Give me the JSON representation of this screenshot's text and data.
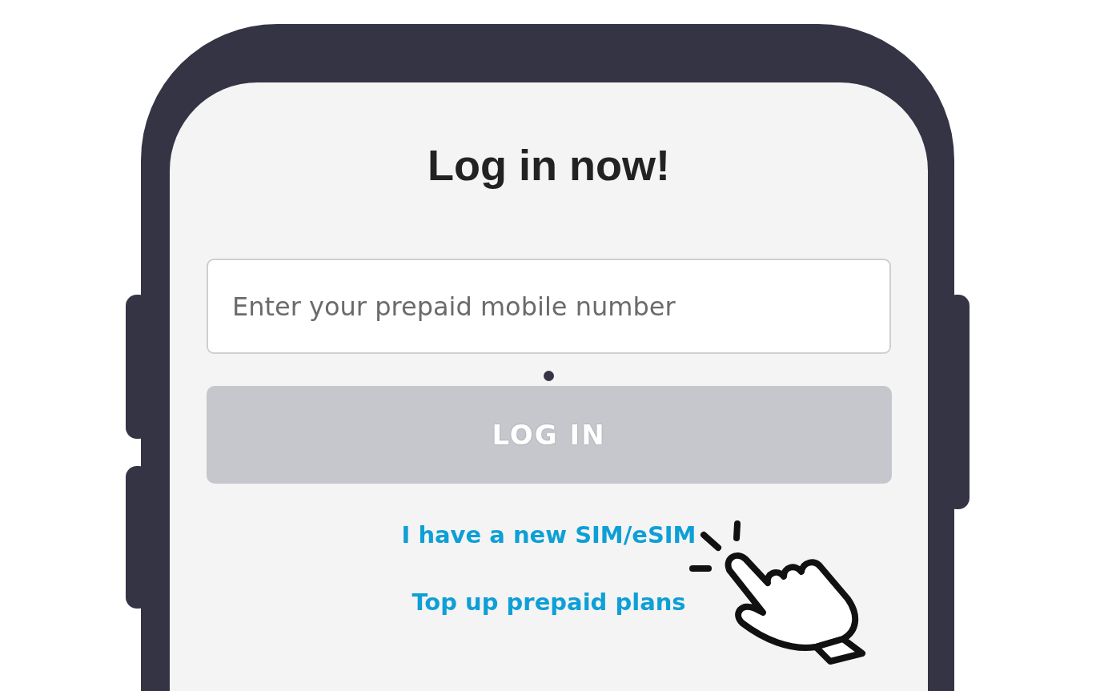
{
  "title": "Log in now!",
  "phone_field": {
    "placeholder": "Enter your prepaid mobile number"
  },
  "login_button": {
    "label": "LOG IN",
    "disabled": true
  },
  "links": [
    "I have a new SIM/eSIM",
    "Top up prepaid plans"
  ]
}
